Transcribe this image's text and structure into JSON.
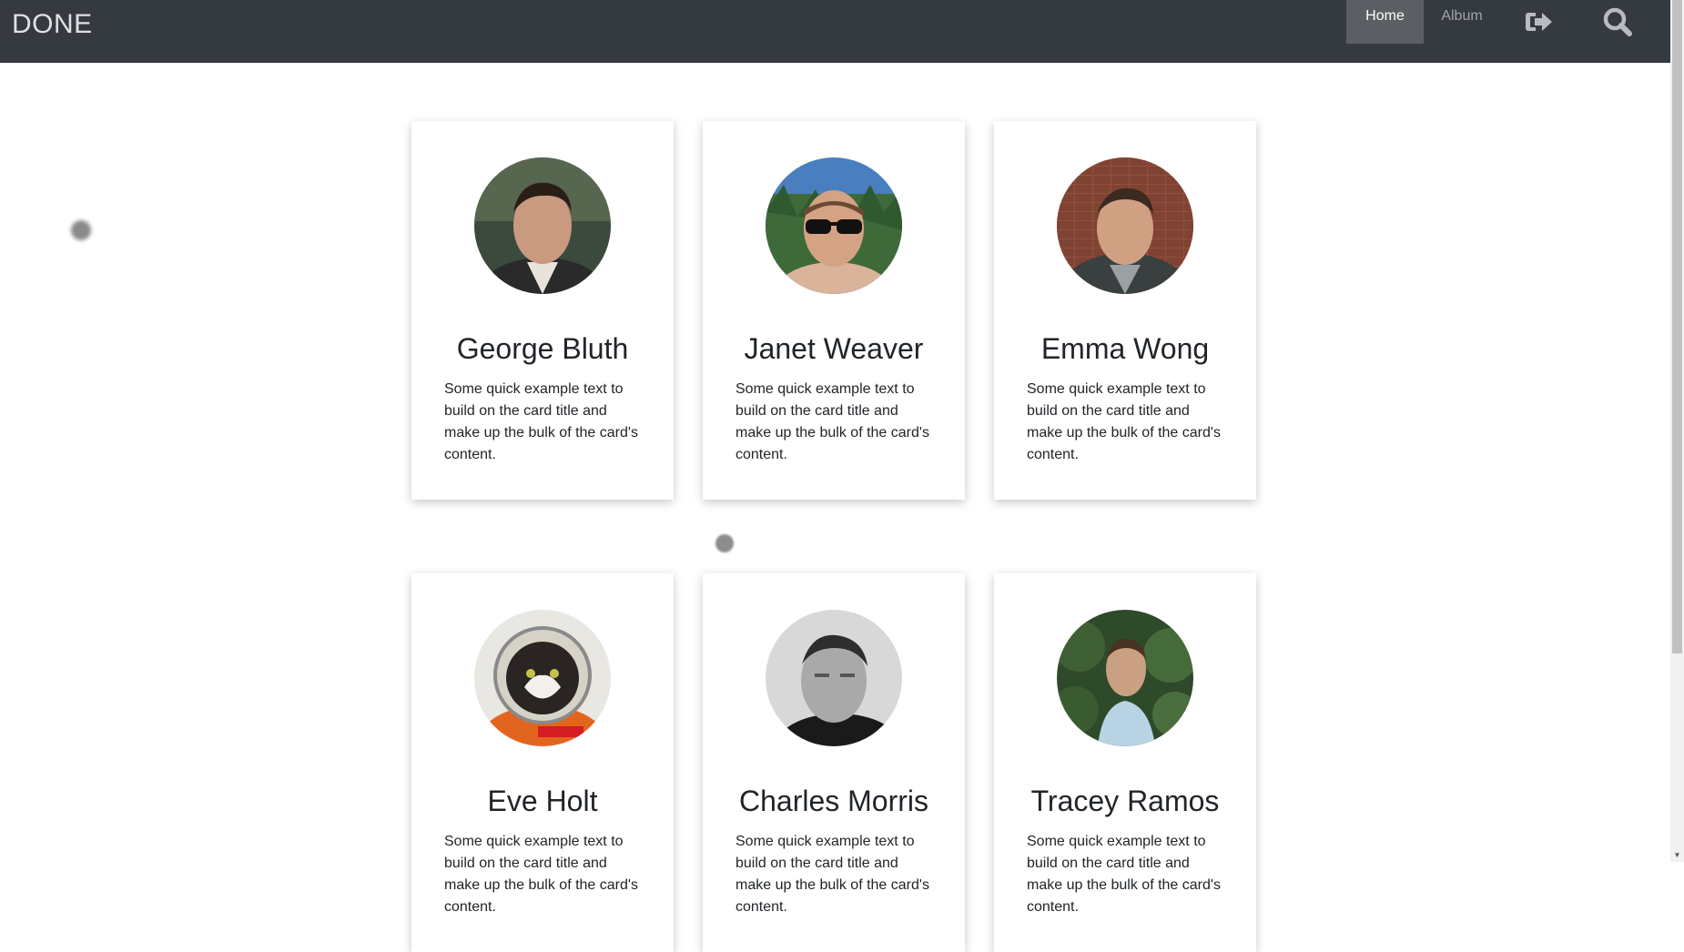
{
  "navbar": {
    "brand": "DONE",
    "links": [
      {
        "label": "Home",
        "active": true
      },
      {
        "label": "Album",
        "active": false
      }
    ],
    "icons": [
      "sign-out-icon",
      "search-icon"
    ]
  },
  "colors": {
    "navbar_bg": "#343a40",
    "active_link_bg": "#5b5f63",
    "card_text": "#212529"
  },
  "cards": [
    {
      "name": "George Bluth",
      "text": "Some quick example text to build on the card title and make up the bulk of the card's content."
    },
    {
      "name": "Janet Weaver",
      "text": "Some quick example text to build on the card title and make up the bulk of the card's content."
    },
    {
      "name": "Emma Wong",
      "text": "Some quick example text to build on the card title and make up the bulk of the card's content."
    },
    {
      "name": "Eve Holt",
      "text": "Some quick example text to build on the card title and make up the bulk of the card's content."
    },
    {
      "name": "Charles Morris",
      "text": "Some quick example text to build on the card title and make up the bulk of the card's content."
    },
    {
      "name": "Tracey Ramos",
      "text": "Some quick example text to build on the card title and make up the bulk of the card's content."
    }
  ],
  "scrollbar": {
    "down_arrow": "▼"
  }
}
